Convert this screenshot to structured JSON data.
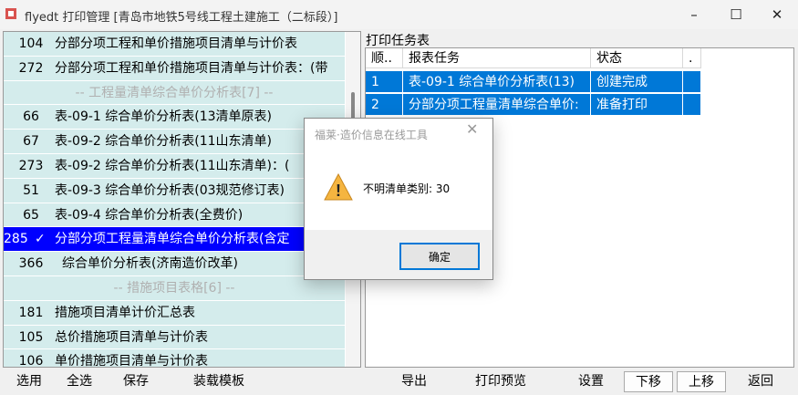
{
  "window": {
    "title": "flyedt 打印管理 [青岛市地铁5号线工程土建施工（二标段）]",
    "min_glyph": "–",
    "max_glyph": "☐",
    "close_glyph": "✕"
  },
  "left_list": {
    "rows": [
      {
        "type": "item",
        "id": "104",
        "name": "分部分项工程和单价措施项目清单与计价表"
      },
      {
        "type": "item",
        "id": "272",
        "name": "分部分项工程和单价措施项目清单与计价表：(带"
      },
      {
        "type": "group",
        "name": "-- 工程量清单综合单价分析表[7] --"
      },
      {
        "type": "item",
        "id": "66",
        "name": "表-09-1 综合单价分析表(13清单原表)"
      },
      {
        "type": "item",
        "id": "67",
        "name": "表-09-2 综合单价分析表(11山东清单)"
      },
      {
        "type": "item",
        "id": "273",
        "name": "表-09-2 综合单价分析表(11山东清单)：("
      },
      {
        "type": "item",
        "id": "51",
        "name": "表-09-3 综合单价分析表(03规范修订表)"
      },
      {
        "type": "item",
        "id": "65",
        "name": "表-09-4 综合单价分析表(全费价)"
      },
      {
        "type": "selected",
        "id": "285",
        "check": "✓",
        "name": "分部分项工程量清单综合单价分析表(含定"
      },
      {
        "type": "indent",
        "id": "366",
        "name": "综合单价分析表(济南造价改革)"
      },
      {
        "type": "group",
        "name": "-- 措施项目表格[6] --"
      },
      {
        "type": "item",
        "id": "181",
        "name": "措施项目清单计价汇总表"
      },
      {
        "type": "item",
        "id": "105",
        "name": "总价措施项目清单与计价表"
      },
      {
        "type": "item",
        "id": "106",
        "name": "单价措施项目清单与计价表"
      }
    ]
  },
  "task_table": {
    "title": "打印任务表",
    "headers": [
      "顺..",
      "报表任务",
      "状态",
      "."
    ],
    "rows": [
      {
        "seq": "1",
        "task": "表-09-1 综合单价分析表(13)",
        "status": "创建完成",
        "extra": ""
      },
      {
        "seq": "2",
        "task": "分部分项工程量清单综合单价:",
        "status": "准备打印",
        "extra": ""
      }
    ]
  },
  "bottom": {
    "select": "选用",
    "select_all": "全选",
    "save": "保存",
    "load_template": "装载模板",
    "export": "导出",
    "preview": "打印预览",
    "settings": "设置",
    "move_down": "下移",
    "move_up": "上移",
    "back": "返回"
  },
  "dialog": {
    "title": "福莱·造价信息在线工具",
    "close_glyph": "✕",
    "message": "不明清单类别: 30",
    "ok": "确定",
    "warning_glyph": "!"
  },
  "colors": {
    "row_bg": "#d4ecec",
    "selected_row": "#0000ff",
    "task_row": "#0078d7",
    "accent": "#0078d7"
  }
}
